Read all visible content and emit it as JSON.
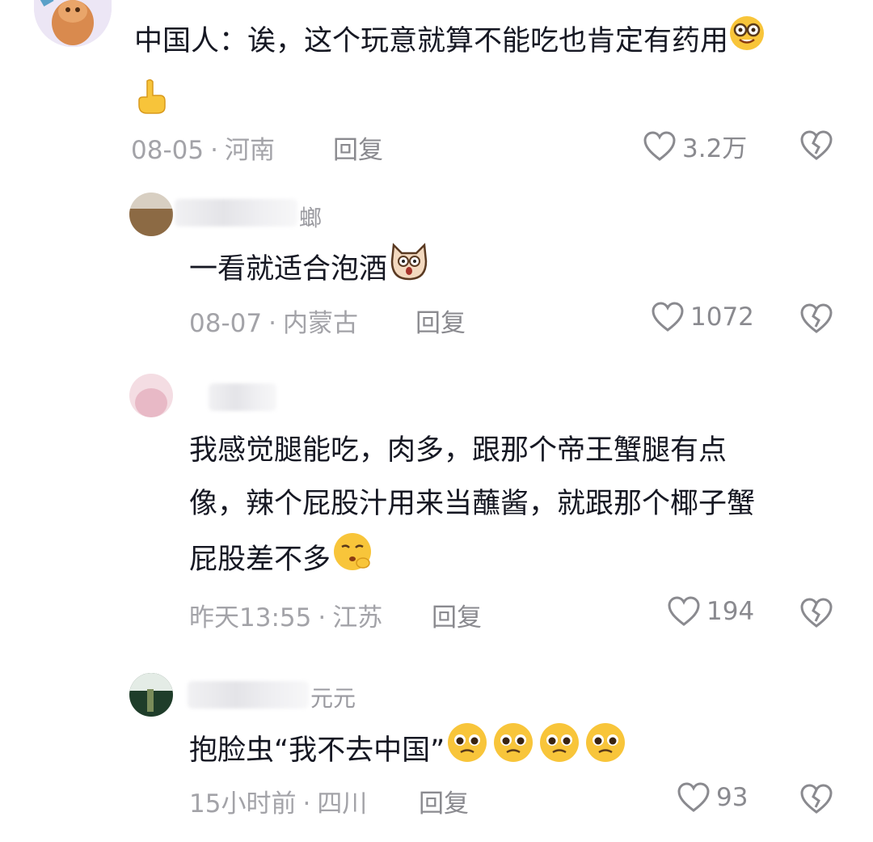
{
  "comments": [
    {
      "text": "中国人：诶，这个玩意就算不能吃也肯定有药用",
      "date": "08-05",
      "location": "河南",
      "reply": "回复",
      "likes": "3.2万"
    },
    {
      "username": "螂",
      "text": "一看就适合泡酒",
      "date": "08-07",
      "location": "内蒙古",
      "reply": "回复",
      "likes": "1072"
    },
    {
      "text_line1": "我感觉腿能吃，肉多，跟那个帝王蟹腿有点",
      "text_line2": "像，辣个屁股汁用来当蘸酱，就跟那个椰子蟹",
      "text_line3": "屁股差不多",
      "date": "昨天13:55",
      "location": "江苏",
      "reply": "回复",
      "likes": "194"
    },
    {
      "username": "元元",
      "text": "抱脸虫“我不去中国”",
      "date": "15小时前",
      "location": "四川",
      "reply": "回复",
      "likes": "93"
    }
  ],
  "separator": "·",
  "icons": [
    "heart-outline-icon",
    "broken-heart-icon",
    "nerd-face-emoji",
    "pointing-down-emoji",
    "dog-face-emoji",
    "kissing-face-emoji",
    "pleading-face-emoji"
  ]
}
